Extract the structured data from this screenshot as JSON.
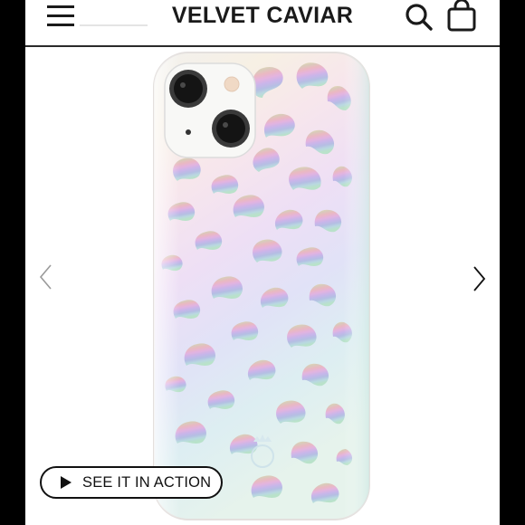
{
  "header": {
    "brand": "VELVET CAVIAR",
    "menu_icon": "hamburger-menu-icon",
    "search_icon": "search-icon",
    "bag_icon": "shopping-bag-icon"
  },
  "gallery": {
    "prev_icon": "chevron-left-icon",
    "next_icon": "chevron-right-icon",
    "product_image": "iridescent-leopard-phone-case",
    "watermark_logo": "VC",
    "action_button": {
      "icon": "play-icon",
      "label": "SEE IT IN ACTION"
    }
  },
  "colors": {
    "accent": "#1a1a1a",
    "button_border": "#111111",
    "frame": "#000000"
  }
}
